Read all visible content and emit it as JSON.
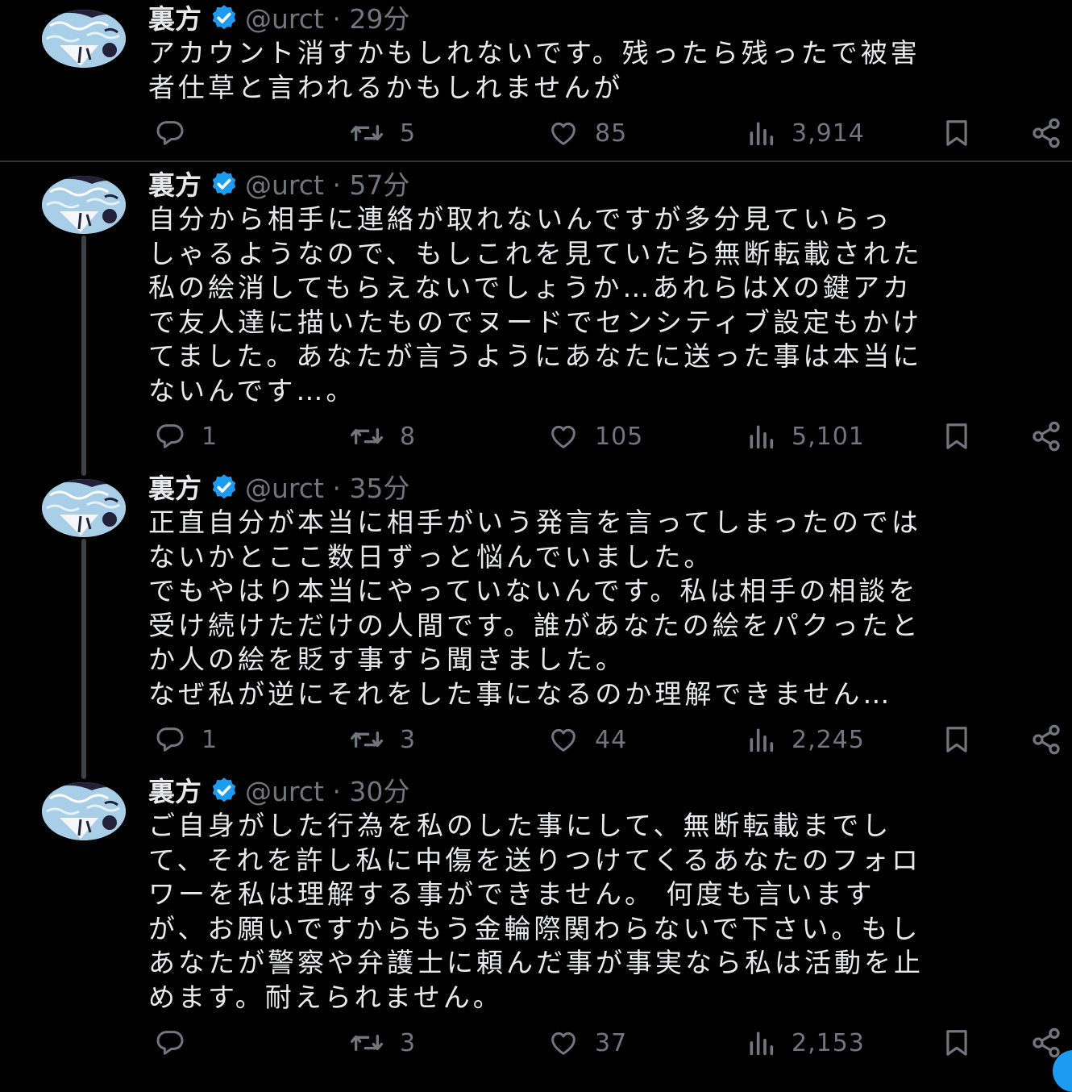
{
  "colors": {
    "background": "#000000",
    "text": "#e7e9ea",
    "secondary": "#71767b",
    "verified": "#1d9bf0",
    "divider": "#2f3336",
    "thread_line": "#3e4144"
  },
  "icons": {
    "reply": "reply-icon",
    "retweet": "retweet-icon",
    "like": "heart-icon",
    "views": "views-icon",
    "bookmark": "bookmark-icon",
    "share": "share-icon",
    "verified": "verified-badge-icon"
  },
  "tweets": [
    {
      "name": "裏方",
      "handle": "@urct",
      "separator": "·",
      "time": "29分",
      "lines": [
        "アカウント消すかもしれないです。残ったら残ったで被害",
        "者仕草と言われるかもしれませんが"
      ],
      "stats": {
        "replies": "",
        "retweets": "5",
        "likes": "85",
        "views": "3,914"
      }
    },
    {
      "name": "裏方",
      "handle": "@urct",
      "separator": "·",
      "time": "57分",
      "lines": [
        "自分から相手に連絡が取れないんですが多分見ていらっ",
        "しゃるようなので、もしこれを見ていたら無断転載された",
        "私の絵消してもらえないでしょうか…あれらはXの鍵アカ",
        "で友人達に描いたものでヌードでセンシティブ設定もかけ",
        "てました。あなたが言うようにあなたに送った事は本当に",
        "ないんです…。"
      ],
      "stats": {
        "replies": "1",
        "retweets": "8",
        "likes": "105",
        "views": "5,101"
      }
    },
    {
      "name": "裏方",
      "handle": "@urct",
      "separator": "·",
      "time": "35分",
      "lines": [
        "正直自分が本当に相手がいう発言を言ってしまったのでは",
        "ないかとここ数日ずっと悩んでいました。",
        "でもやはり本当にやっていないんです。私は相手の相談を",
        "受け続けただけの人間です。誰があなたの絵をパクったと",
        "か人の絵を貶す事すら聞きました。",
        "なぜ私が逆にそれをした事になるのか理解できません…"
      ],
      "stats": {
        "replies": "1",
        "retweets": "3",
        "likes": "44",
        "views": "2,245"
      }
    },
    {
      "name": "裏方",
      "handle": "@urct",
      "separator": "·",
      "time": "30分",
      "lines": [
        "ご自身がした行為を私のした事にして、無断転載までし",
        "て、それを許し私に中傷を送りつけてくるあなたのフォロ",
        "ワーを私は理解する事ができません。 何度も言います",
        "が、お願いですからもう金輪際関わらないで下さい。もし",
        "あなたが警察や弁護士に頼んだ事が事実なら私は活動を止",
        "めます。耐えられません。"
      ],
      "stats": {
        "replies": "",
        "retweets": "3",
        "likes": "37",
        "views": "2,153"
      }
    }
  ]
}
